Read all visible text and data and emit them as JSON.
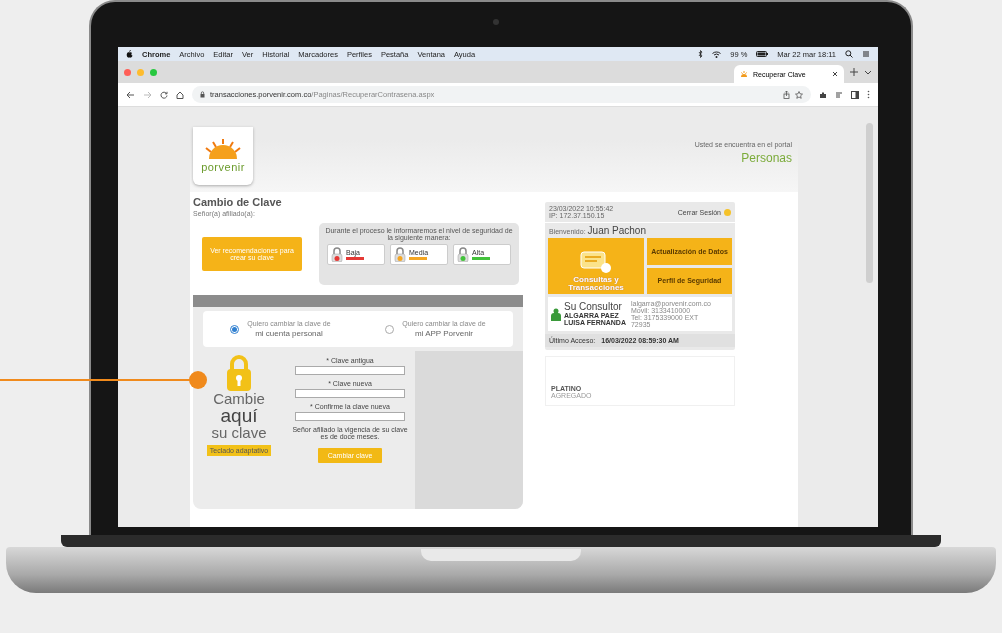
{
  "menu_bar": {
    "app": "Chrome",
    "items": [
      "Archivo",
      "Editar",
      "Ver",
      "Historial",
      "Marcadores",
      "Perfiles",
      "Pestaña",
      "Ventana",
      "Ayuda"
    ],
    "battery": "99 %",
    "clock": "Mar 22 mar  18:11"
  },
  "browser": {
    "tab_title": "Recuperar Clave",
    "url_host": "transacciones.porvenir.com.co",
    "url_path": "/Paginas/RecuperarContrasena.aspx"
  },
  "header": {
    "logo": "porvenir",
    "portal_note": "Usted se encuentra en el portal",
    "portal": "Personas"
  },
  "form": {
    "title": "Cambio de Clave",
    "greeting": "Señor(a) afiliado(a):",
    "recommendations_button": "Ver recomendaciones para crear su clave",
    "security_note": "Durante el proceso le informaremos el nivel de seguridad de la siguiente manera:",
    "levels": [
      {
        "label": "Baja",
        "color": "#e53935"
      },
      {
        "label": "Media",
        "color": "#f5a623"
      },
      {
        "label": "Alta",
        "color": "#43c23b"
      }
    ],
    "options": [
      {
        "caption": "Quiero cambiar la clave de",
        "label": "mi cuenta personal",
        "selected": true
      },
      {
        "caption": "Quiero cambiar la clave de",
        "label": "mi APP Porvenir",
        "selected": false
      }
    ],
    "promo": {
      "line1": "Cambie",
      "line2": "aquí",
      "line3": "su clave",
      "badge": "Teclado adaptativo"
    },
    "fields": [
      {
        "label": "* Clave antigua"
      },
      {
        "label": "* Clave nueva"
      },
      {
        "label": "* Confirme la clave nueva"
      }
    ],
    "validity_note": "Señor afiliado la vigencia de su clave es de doce meses.",
    "submit": "Cambiar clave"
  },
  "session": {
    "timestamp": "23/03/2022 10:55:42",
    "ip": "IP: 172.37.150.15",
    "logout": "Cerrar Sesión",
    "welcome": "Bienvenido:",
    "user": "Juan Pachon",
    "main_tile": "Consultas y Transacciones",
    "side_tiles": [
      "Actualización de Datos",
      "Perfil de Seguridad"
    ],
    "consultant": {
      "title": "Su Consultor",
      "name": "ALGARRA PAEZ",
      "surname": "LUISA FERNANDA",
      "contact": [
        "lalgarra@porvenir.com.co",
        "Movil: 3133410000",
        "Tel: 3175339000 EXT",
        "72935"
      ]
    },
    "last_access_label": "Último Acceso:",
    "last_access": "16/03/2022 08:59:30 AM",
    "segment": "PLATINO",
    "segment_note": "AGREGADO"
  }
}
